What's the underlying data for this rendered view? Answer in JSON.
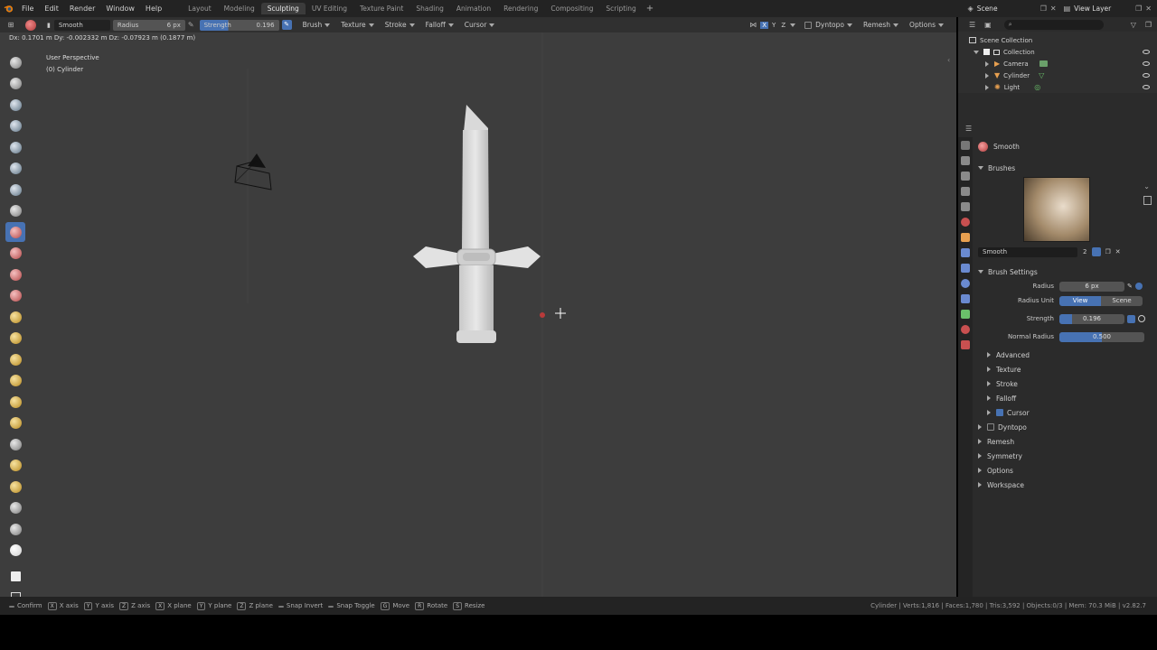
{
  "topbar": {
    "menus": [
      "File",
      "Edit",
      "Render",
      "Window",
      "Help"
    ],
    "workspaces": [
      "Layout",
      "Modeling",
      "Sculpting",
      "UV Editing",
      "Texture Paint",
      "Shading",
      "Animation",
      "Rendering",
      "Compositing",
      "Scripting"
    ],
    "active_workspace": "Sculpting",
    "scene": "Scene",
    "view_layer": "View Layer"
  },
  "toolheader": {
    "brush_name": "Smooth",
    "radius_label": "Radius",
    "radius_value": "6 px",
    "strength_label": "Strength",
    "strength_value": "0.196",
    "dropdowns": [
      "Brush",
      "Texture",
      "Stroke",
      "Falloff",
      "Cursor"
    ],
    "axes": [
      "X",
      "Y",
      "Z"
    ],
    "right_dropdowns": [
      "Dyntopo",
      "Remesh",
      "Options"
    ]
  },
  "viewport": {
    "status_line": "Dx: 0.1701 m  Dy: -0.002332 m  Dz: -0.07923 m (0.1877 m)",
    "view_name": "User Perspective",
    "object_name": "(0) Cylinder"
  },
  "outliner": {
    "root": "Scene Collection",
    "collection": "Collection",
    "items": [
      "Camera",
      "Cylinder",
      "Light"
    ]
  },
  "properties": {
    "active_brush": "Smooth",
    "brushes_header": "Brushes",
    "brush_field": "Smooth",
    "brush_users": "2",
    "brush_settings_header": "Brush Settings",
    "radius_label": "Radius",
    "radius_value": "6 px",
    "radius_unit_label": "Radius Unit",
    "radius_unit_view": "View",
    "radius_unit_scene": "Scene",
    "strength_label": "Strength",
    "strength_value": "0.196",
    "strength_fraction": 0.196,
    "normal_radius_label": "Normal Radius",
    "normal_radius_value": "0.500",
    "normal_radius_fraction": 0.5,
    "subpanels": [
      "Advanced",
      "Texture",
      "Stroke",
      "Falloff"
    ],
    "cursor_label": "Cursor",
    "sections": [
      "Dyntopo",
      "Remesh",
      "Symmetry",
      "Options",
      "Workspace"
    ]
  },
  "statusbar": {
    "hints": [
      {
        "key": "",
        "label": "Confirm"
      },
      {
        "key": "X",
        "label": "X axis"
      },
      {
        "key": "Y",
        "label": "Y axis"
      },
      {
        "key": "Z",
        "label": "Z axis"
      },
      {
        "key": "X",
        "label": "X plane"
      },
      {
        "key": "Y",
        "label": "Y plane"
      },
      {
        "key": "Z",
        "label": "Z plane"
      },
      {
        "key": "",
        "label": "Snap Invert"
      },
      {
        "key": "",
        "label": "Snap Toggle"
      },
      {
        "key": "G",
        "label": "Move"
      },
      {
        "key": "R",
        "label": "Rotate"
      },
      {
        "key": "S",
        "label": "Resize"
      }
    ],
    "stats": "Cylinder | Verts:1,816 | Faces:1,780 | Tris:3,592 | Objects:0/3 | Mem: 70.3 MiB | v2.82.7"
  },
  "colors": {
    "accent": "#4772b3",
    "viewport_bg": "#3d3d3d",
    "panel_bg": "#2b2b2b"
  }
}
